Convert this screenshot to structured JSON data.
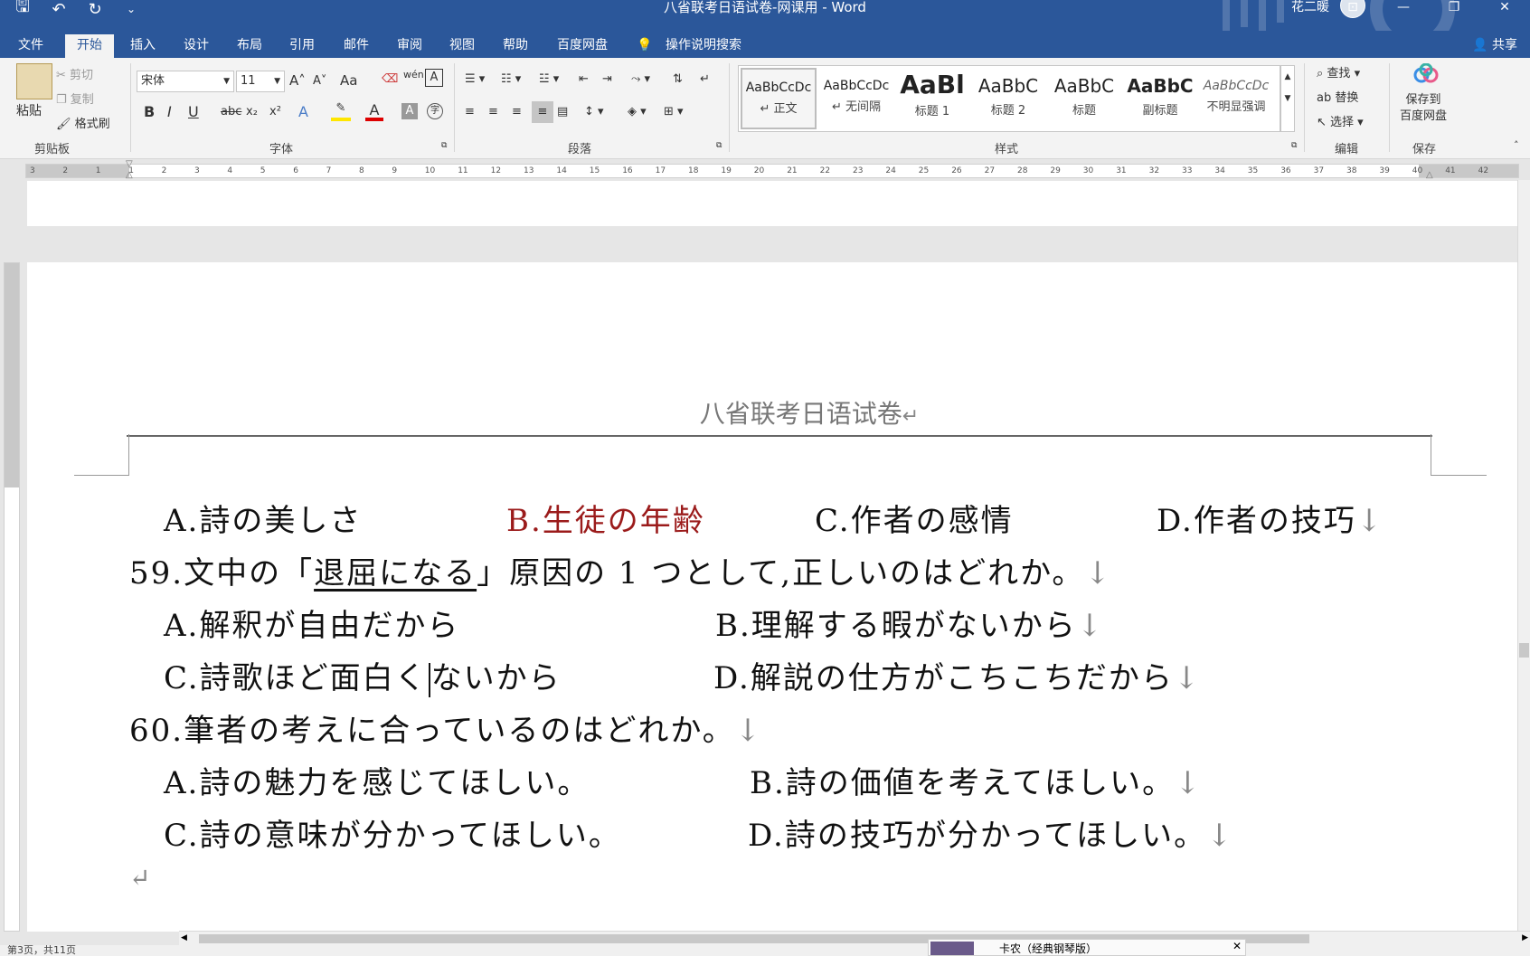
{
  "window": {
    "title": "八省联考日语试卷-网课用  -  Word",
    "user": "花二暖",
    "qat": {
      "save": "🖫",
      "undo": "↶",
      "redo": "↻",
      "customize": "⌄"
    },
    "controls": {
      "ribbon_display": "⊡",
      "minimize": "—",
      "restore": "❐",
      "close": "✕"
    }
  },
  "tabs": [
    "文件",
    "开始",
    "插入",
    "设计",
    "布局",
    "引用",
    "邮件",
    "审阅",
    "视图",
    "帮助",
    "百度网盘"
  ],
  "active_tab": "开始",
  "tell_me": "操作说明搜索",
  "share": "共享",
  "ribbon": {
    "clipboard": {
      "label": "剪贴板",
      "paste": "粘贴",
      "cut": "剪切",
      "copy": "复制",
      "format_painter": "格式刷"
    },
    "font": {
      "label": "字体",
      "name": "宋体",
      "size": "11",
      "grow": "A˄",
      "shrink": "A˅",
      "case": "Aa",
      "bold": "B",
      "italic": "I",
      "underline": "U",
      "strike": "abc",
      "sub": "x₂",
      "sup": "x²"
    },
    "paragraph": {
      "label": "段落"
    },
    "styles": {
      "label": "样式",
      "items": [
        {
          "sample": "AaBbCcDc",
          "name": "↵ 正文"
        },
        {
          "sample": "AaBbCcDc",
          "name": "↵ 无间隔"
        },
        {
          "sample": "AaBl",
          "name": "标题 1"
        },
        {
          "sample": "AaBbC",
          "name": "标题 2"
        },
        {
          "sample": "AaBbC",
          "name": "标题"
        },
        {
          "sample": "AaBbC",
          "name": "副标题"
        },
        {
          "sample": "AaBbCcDc",
          "name": "不明显强调"
        }
      ]
    },
    "editing": {
      "label": "编辑",
      "find": "查找",
      "replace": "替换",
      "select": "选择"
    },
    "save": {
      "label": "保存",
      "button": "保存到\n百度网盘"
    }
  },
  "ruler_numbers": [
    "3",
    "2",
    "1",
    "1",
    "2",
    "3",
    "4",
    "5",
    "6",
    "7",
    "8",
    "9",
    "10",
    "11",
    "12",
    "13",
    "14",
    "15",
    "16",
    "17",
    "18",
    "19",
    "20",
    "21",
    "22",
    "23",
    "24",
    "25",
    "26",
    "27",
    "28",
    "29",
    "30",
    "31",
    "32",
    "33",
    "34",
    "35",
    "36",
    "37",
    "38",
    "39",
    "40",
    "41",
    "42"
  ],
  "document": {
    "header": "八省联考日语试卷",
    "header_mark": "↵",
    "lines": {
      "q58_a": "A.詩の美しさ",
      "q58_b": "B.生徒の年齢",
      "q58_c": "C.作者の感情",
      "q58_d": "D.作者の技巧",
      "q59_prefix": "59.文中の「",
      "q59_underlined": "退屈になる",
      "q59_suffix": "」原因の 1 つとして,正しいのはどれか。",
      "q59_a": "A.解釈が自由だから",
      "q59_b": "B.理解する暇がないから",
      "q59_c_before": "C.詩歌ほど面白く",
      "q59_c_after": "ないから",
      "q59_d": "D.解説の仕方がこちこちだから",
      "q60": "60.筆者の考えに合っているのはどれか。",
      "q60_a": "A.詩の魅力を感じてほしい。",
      "q60_b": "B.詩の価値を考えてほしい。",
      "q60_c": "C.詩の意味が分かってほしい。",
      "q60_d": "D.詩の技巧が分かってほしい。",
      "end_mark": "↵",
      "line_break_mark": "↓"
    }
  },
  "status": {
    "page": "第3页，共11页",
    "popup_text": "卡农（经典钢琴版）"
  },
  "colors": {
    "accent": "#2b579a",
    "answer_red": "#9b1b1b"
  }
}
